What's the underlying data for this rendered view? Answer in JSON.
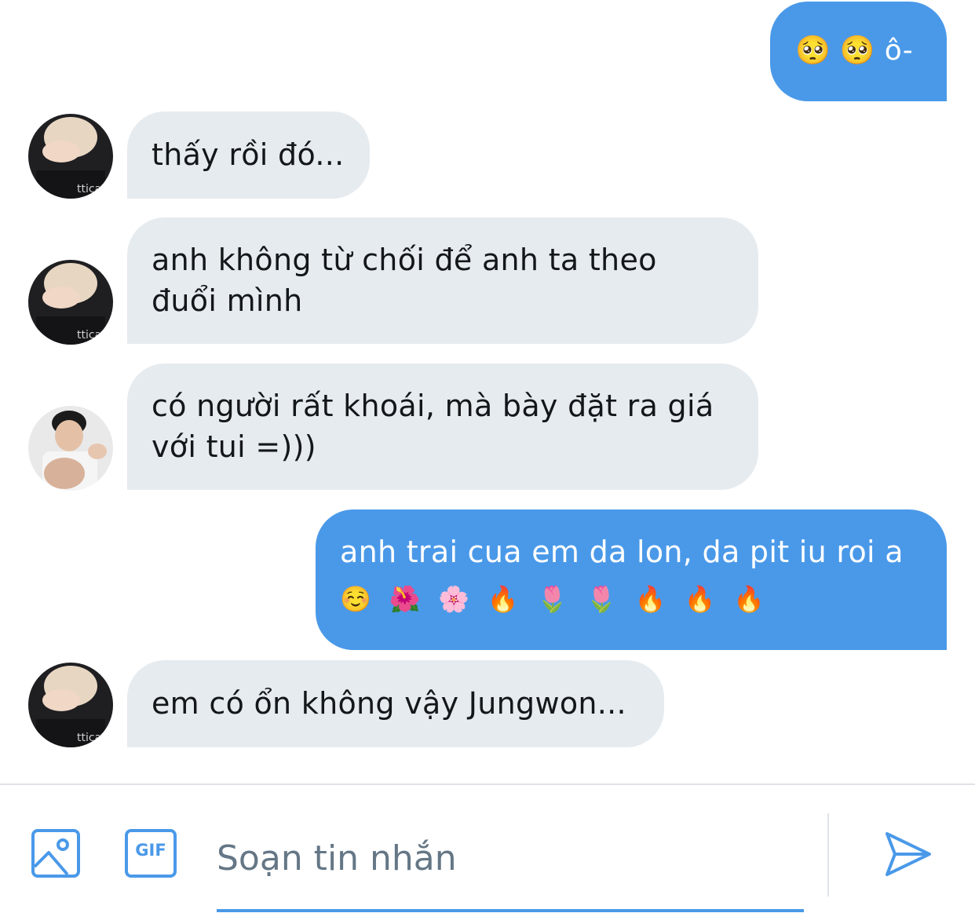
{
  "messages": [
    {
      "direction": "out",
      "text": "🥺 🥺  ô-"
    },
    {
      "direction": "in",
      "text": "thấy rồi đó..."
    },
    {
      "direction": "in",
      "text": "anh không từ chối để anh ta theo đuổi mình"
    },
    {
      "direction": "in",
      "text": "có người rất khoái, mà bày đặt ra giá với tui =)))"
    },
    {
      "direction": "out",
      "text": "anh trai cua em da lon, da pit iu roi a",
      "emojis": [
        "☺️",
        "🌺",
        "🌸",
        "🔥",
        "🌷",
        "🌷",
        "🔥",
        "🔥",
        "🔥"
      ]
    },
    {
      "direction": "in",
      "text": "em có ổn không vậy Jungwon..."
    }
  ],
  "composer": {
    "placeholder": "Soạn tin nhắn",
    "gif_label": "GIF",
    "icons": [
      "image-icon",
      "gif-icon",
      "send-icon"
    ]
  },
  "colors": {
    "accent": "#4a99e9",
    "incoming_bubble": "#e6ebef",
    "outgoing_bubble": "#4a99e9"
  }
}
